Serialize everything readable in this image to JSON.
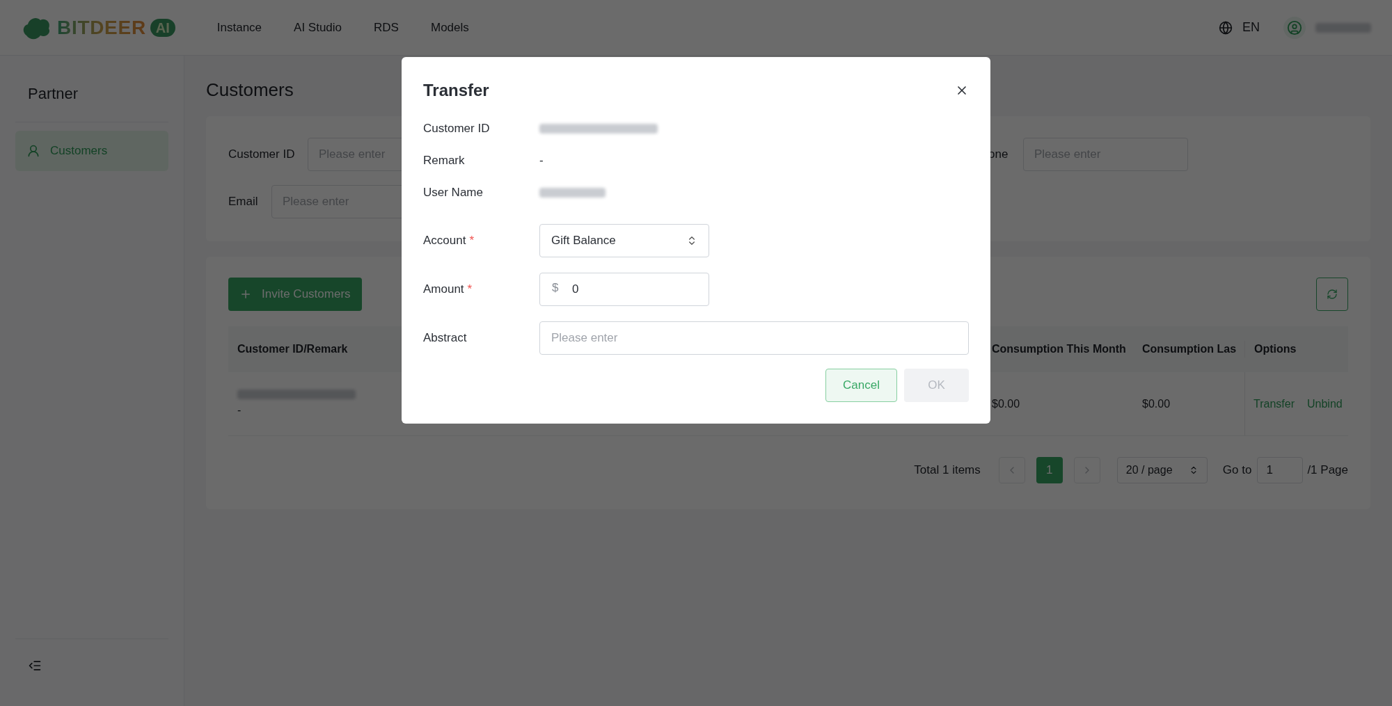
{
  "header": {
    "logo": {
      "text": "BITDEER",
      "badge": "AI"
    },
    "nav": [
      {
        "label": "Instance"
      },
      {
        "label": "AI Studio"
      },
      {
        "label": "RDS"
      },
      {
        "label": "Models"
      }
    ],
    "language": "EN"
  },
  "sidebar": {
    "title": "Partner",
    "items": [
      {
        "label": "Customers",
        "selected": true
      }
    ]
  },
  "page": {
    "title": "Customers",
    "filters": [
      {
        "label": "Customer ID",
        "placeholder": "Please enter"
      },
      {
        "label": "one",
        "placeholder": "Please enter"
      },
      {
        "label": "Email",
        "placeholder": "Please enter"
      }
    ],
    "invite_button": "Invite Customers",
    "table": {
      "columns": [
        "Customer ID/Remark",
        "Consumption This Month",
        "Consumption Las",
        "Options"
      ],
      "rows": [
        {
          "remark": "-",
          "consumption_this_month": "$0.00",
          "consumption_last_month": "$0.00",
          "actions": [
            "Transfer",
            "Unbind"
          ]
        }
      ]
    },
    "pagination": {
      "total": "Total 1 items",
      "pages": [
        {
          "label": "1",
          "selected": true
        }
      ],
      "page_size": "20 / page",
      "goto_label": "Go to",
      "goto_value": "1",
      "page_count": "/1 Page"
    }
  },
  "dialog": {
    "title": "Transfer",
    "fields": [
      {
        "kind": "redacted",
        "label": "Customer ID"
      },
      {
        "kind": "text",
        "label": "Remark",
        "value": "-"
      },
      {
        "kind": "redacted",
        "label": "User Name"
      },
      {
        "kind": "select",
        "label": "Account",
        "required_mark": "*",
        "value": "Gift Balance"
      },
      {
        "kind": "amount",
        "label": "Amount",
        "required_mark": "*",
        "prefix": "$",
        "value": "0"
      },
      {
        "kind": "input",
        "label": "Abstract",
        "placeholder": "Please enter"
      }
    ],
    "buttons": [
      {
        "label": "Cancel",
        "disabled": false
      },
      {
        "label": "OK",
        "disabled": true
      }
    ]
  }
}
